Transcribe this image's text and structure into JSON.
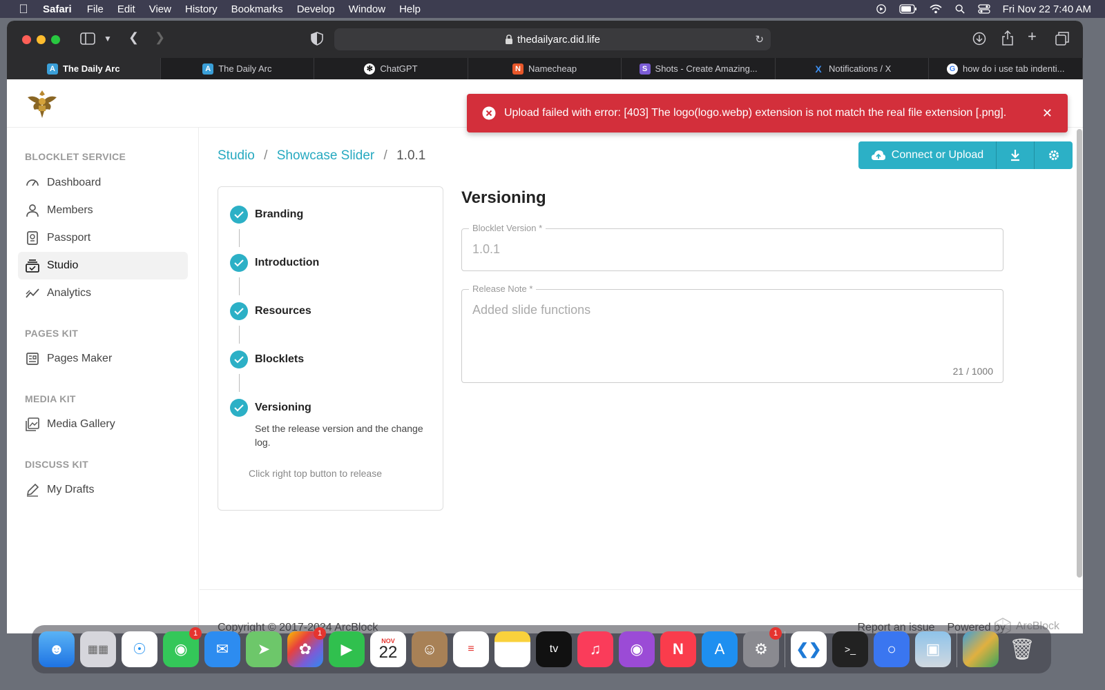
{
  "menubar": {
    "app": "Safari",
    "items": [
      "File",
      "Edit",
      "View",
      "History",
      "Bookmarks",
      "Develop",
      "Window",
      "Help"
    ],
    "datetime": "Fri Nov 22  7:40 AM"
  },
  "browser": {
    "url": "thedailyarc.did.life",
    "tabs": [
      {
        "label": "The Daily Arc",
        "icon": "daily-arc-icon",
        "active": true
      },
      {
        "label": "The Daily Arc",
        "icon": "daily-arc-icon",
        "active": false
      },
      {
        "label": "ChatGPT",
        "icon": "chatgpt-icon",
        "active": false
      },
      {
        "label": "Namecheap",
        "icon": "namecheap-icon",
        "active": false
      },
      {
        "label": "Shots - Create Amazing...",
        "icon": "shots-icon",
        "active": false
      },
      {
        "label": "Notifications / X",
        "icon": "x-icon",
        "active": false
      },
      {
        "label": "how do i use tab indenti...",
        "icon": "google-icon",
        "active": false
      }
    ]
  },
  "toast": {
    "message": "Upload failed with error: [403] The logo(logo.webp) extension is not match the real file extension [.png].",
    "color": "#d32f3b"
  },
  "sidebar": {
    "sections": [
      {
        "title": "BLOCKLET SERVICE",
        "items": [
          {
            "label": "Dashboard",
            "icon": "dashboard-icon"
          },
          {
            "label": "Members",
            "icon": "person-icon"
          },
          {
            "label": "Passport",
            "icon": "passport-icon"
          },
          {
            "label": "Studio",
            "icon": "studio-icon",
            "active": true
          },
          {
            "label": "Analytics",
            "icon": "analytics-icon"
          }
        ]
      },
      {
        "title": "PAGES KIT",
        "items": [
          {
            "label": "Pages Maker",
            "icon": "pages-icon"
          }
        ]
      },
      {
        "title": "MEDIA KIT",
        "items": [
          {
            "label": "Media Gallery",
            "icon": "gallery-icon"
          }
        ]
      },
      {
        "title": "DISCUSS KIT",
        "items": [
          {
            "label": "My Drafts",
            "icon": "pen-icon"
          }
        ]
      }
    ]
  },
  "breadcrumb": {
    "root": "Studio",
    "section": "Showcase Slider",
    "current": "1.0.1",
    "sep": "/"
  },
  "actions": {
    "upload_label": "Connect or Upload",
    "accent": "#2cb0c6"
  },
  "steps": {
    "items": [
      "Branding",
      "Introduction",
      "Resources",
      "Blocklets",
      "Versioning"
    ],
    "active_desc": "Set the release version and the change log.",
    "hint": "Click right top button to release"
  },
  "form": {
    "title": "Versioning",
    "version_label": "Blocklet Version *",
    "version_value": "1.0.1",
    "note_label": "Release Note *",
    "note_value": "Added slide functions",
    "note_count": "21 / 1000"
  },
  "footer": {
    "copyright": "Copyright © 2017-2024  ArcBlock",
    "report": "Report an issue",
    "powered": "Powered by",
    "brand": "ArcBlock"
  },
  "dock": {
    "calendar_month": "NOV",
    "calendar_day": "22",
    "badge_messages": "1",
    "badge_photos": "1",
    "badge_settings": "1"
  }
}
